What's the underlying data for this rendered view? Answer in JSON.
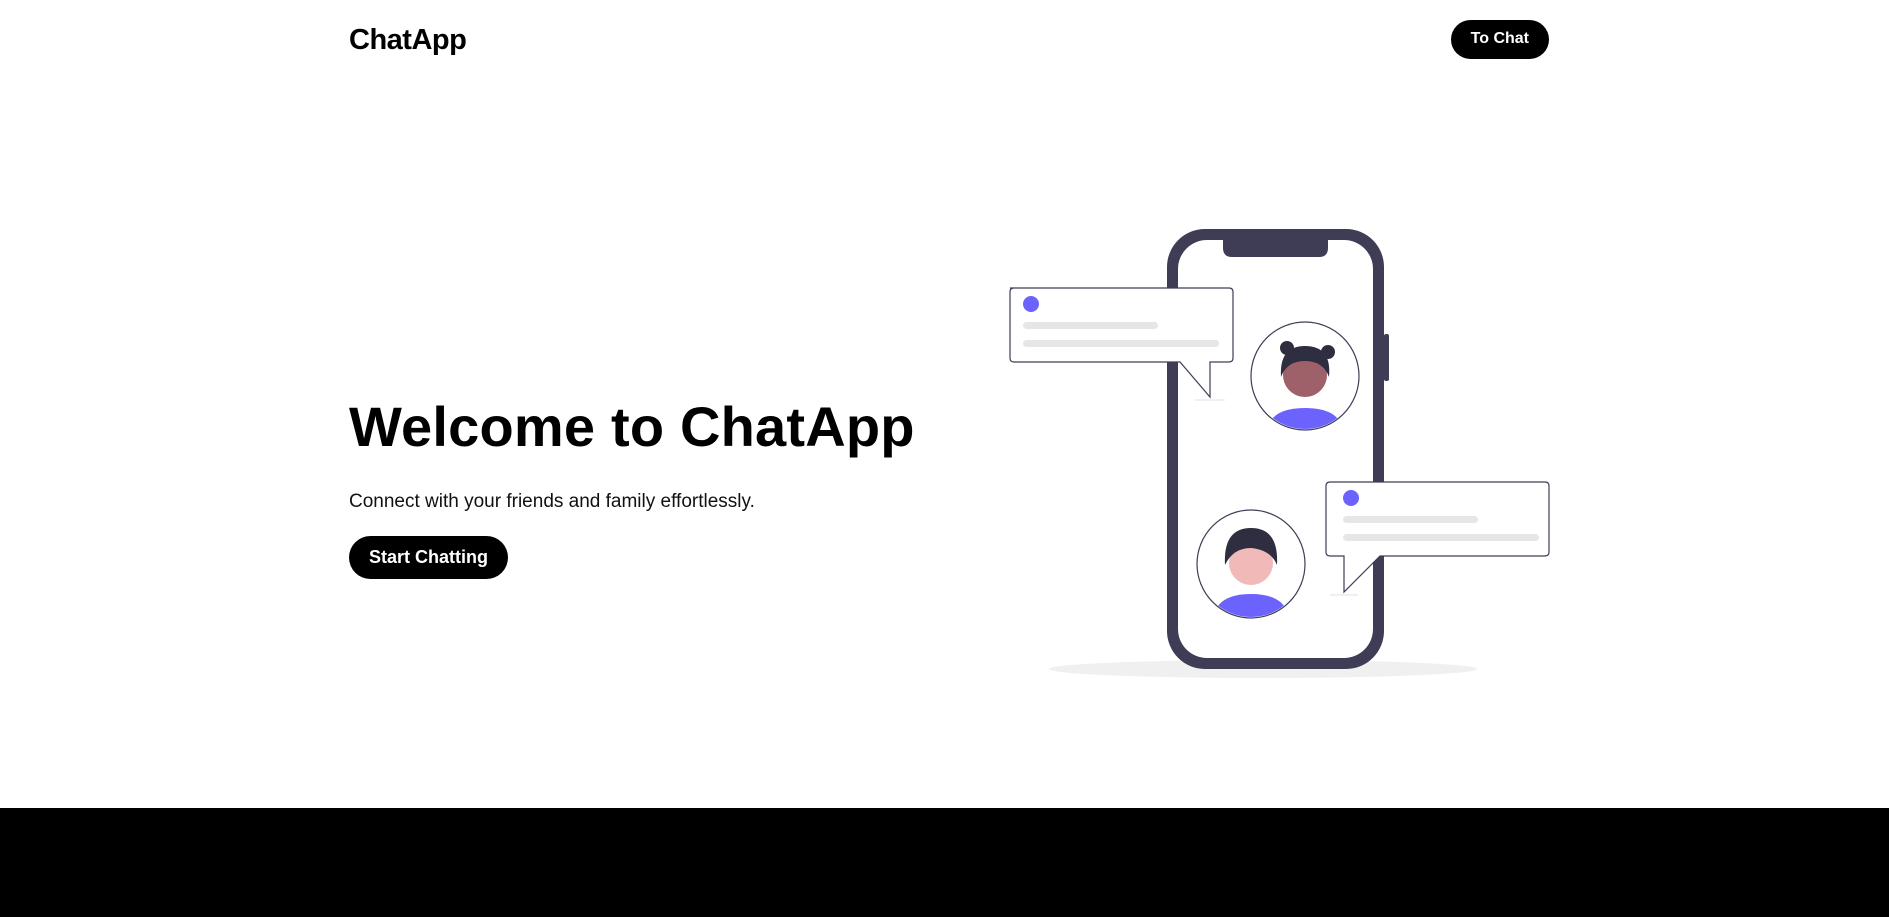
{
  "nav": {
    "brand": "ChatApp",
    "to_chat_label": "To Chat"
  },
  "hero": {
    "title": "Welcome to ChatApp",
    "subtitle": "Connect with your friends and family effortlessly.",
    "cta_label": "Start Chatting"
  },
  "illustration": {
    "icon": "phone-chat-illustration",
    "colors": {
      "phone": "#3f3d56",
      "accent": "#6c63ff",
      "skin_dark": "#9e616a",
      "skin_light": "#f2b9b9",
      "hair": "#2f2e41",
      "placeholder_line": "#e6e6e6"
    }
  },
  "colors": {
    "primary": "#000000",
    "background": "#ffffff"
  }
}
